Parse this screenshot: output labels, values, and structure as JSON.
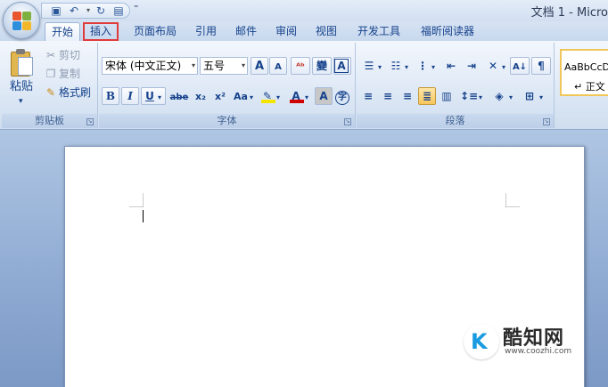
{
  "titlebar": {
    "doc_title": "文档 1 - Micro",
    "qat": [
      "save-icon",
      "undo-icon",
      "redo-icon",
      "print-preview-icon"
    ],
    "customize_glyph": "⁼"
  },
  "tabs": [
    {
      "label": "开始",
      "active": true
    },
    {
      "label": "插入",
      "highlighted": true
    },
    {
      "label": "页面布局"
    },
    {
      "label": "引用"
    },
    {
      "label": "邮件"
    },
    {
      "label": "审阅"
    },
    {
      "label": "视图"
    },
    {
      "label": "开发工具"
    },
    {
      "label": "福昕阅读器"
    }
  ],
  "clipboard": {
    "group_label": "剪贴板",
    "paste": "粘贴",
    "paste_arrow": "▾",
    "cut": "剪切",
    "copy": "复制",
    "format_painter": "格式刷"
  },
  "font": {
    "group_label": "字体",
    "font_name": "宋体 (中文正文)",
    "font_size": "五号",
    "grow": "A",
    "shrink": "A",
    "clear": "ᴬᵇ",
    "phonetic": "變",
    "border": "A",
    "bold": "B",
    "italic": "I",
    "underline": "U",
    "strikethrough": "abe",
    "subscript": "x₂",
    "superscript": "x²",
    "change_case": "Aa",
    "text_highlight_color": "#f5e400",
    "font_color": "#d00000",
    "char_shading": "A",
    "enclose": "字"
  },
  "paragraph": {
    "group_label": "段落"
  },
  "styles": {
    "normal_preview": "AaBbCcD",
    "normal_label": "↵ 正文"
  },
  "watermark": {
    "name": "酷知网",
    "url": "www.coozhi.com",
    "logo_letter": "K"
  }
}
